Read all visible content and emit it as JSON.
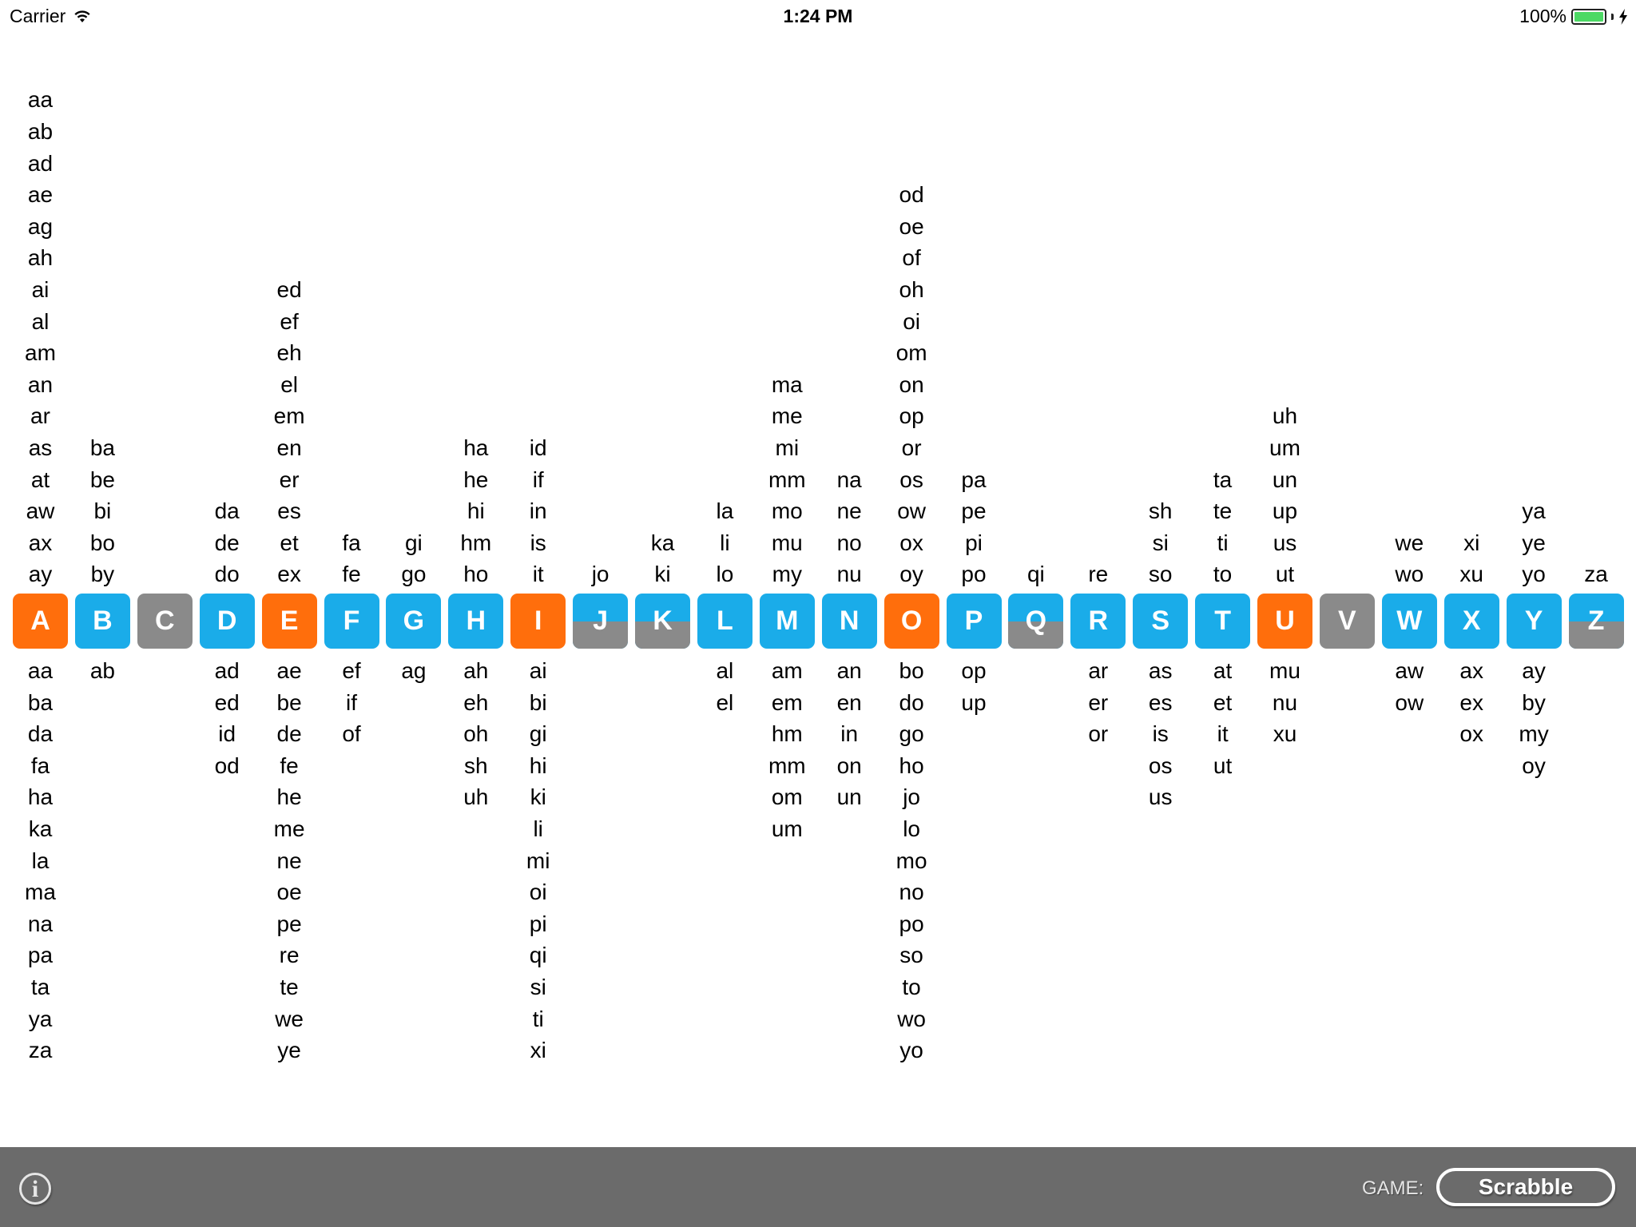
{
  "status_bar": {
    "carrier": "Carrier",
    "time": "1:24 PM",
    "battery_percent": "100%",
    "battery_level": 1.0
  },
  "colors": {
    "vowel": "#ff6e0c",
    "consonant": "#1aace9",
    "unused": "#8a8a8a",
    "toolbar": "#6b6b6b"
  },
  "letters": [
    {
      "letter": "A",
      "style": "vowel",
      "starts": [
        "aa",
        "ab",
        "ad",
        "ae",
        "ag",
        "ah",
        "ai",
        "al",
        "am",
        "an",
        "ar",
        "as",
        "at",
        "aw",
        "ax",
        "ay"
      ],
      "ends": [
        "aa",
        "ba",
        "da",
        "fa",
        "ha",
        "ka",
        "la",
        "ma",
        "na",
        "pa",
        "ta",
        "ya",
        "za"
      ]
    },
    {
      "letter": "B",
      "style": "consonant",
      "starts": [
        "ba",
        "be",
        "bi",
        "bo",
        "by"
      ],
      "ends": [
        "ab"
      ]
    },
    {
      "letter": "C",
      "style": "unused",
      "starts": [],
      "ends": []
    },
    {
      "letter": "D",
      "style": "consonant",
      "starts": [
        "da",
        "de",
        "do"
      ],
      "ends": [
        "ad",
        "ed",
        "id",
        "od"
      ]
    },
    {
      "letter": "E",
      "style": "vowel",
      "starts": [
        "ed",
        "ef",
        "eh",
        "el",
        "em",
        "en",
        "er",
        "es",
        "et",
        "ex"
      ],
      "ends": [
        "ae",
        "be",
        "de",
        "fe",
        "he",
        "me",
        "ne",
        "oe",
        "pe",
        "re",
        "te",
        "we",
        "ye"
      ]
    },
    {
      "letter": "F",
      "style": "consonant",
      "starts": [
        "fa",
        "fe"
      ],
      "ends": [
        "ef",
        "if",
        "of"
      ]
    },
    {
      "letter": "G",
      "style": "consonant",
      "starts": [
        "gi",
        "go"
      ],
      "ends": [
        "ag"
      ]
    },
    {
      "letter": "H",
      "style": "consonant",
      "starts": [
        "ha",
        "he",
        "hi",
        "hm",
        "ho"
      ],
      "ends": [
        "ah",
        "eh",
        "oh",
        "sh",
        "uh"
      ]
    },
    {
      "letter": "I",
      "style": "vowel",
      "starts": [
        "id",
        "if",
        "in",
        "is",
        "it"
      ],
      "ends": [
        "ai",
        "bi",
        "gi",
        "hi",
        "ki",
        "li",
        "mi",
        "oi",
        "pi",
        "qi",
        "si",
        "ti",
        "xi"
      ]
    },
    {
      "letter": "J",
      "style": "half",
      "starts": [
        "jo"
      ],
      "ends": []
    },
    {
      "letter": "K",
      "style": "half",
      "starts": [
        "ka",
        "ki"
      ],
      "ends": []
    },
    {
      "letter": "L",
      "style": "consonant",
      "starts": [
        "la",
        "li",
        "lo"
      ],
      "ends": [
        "al",
        "el"
      ]
    },
    {
      "letter": "M",
      "style": "consonant",
      "starts": [
        "ma",
        "me",
        "mi",
        "mm",
        "mo",
        "mu",
        "my"
      ],
      "ends": [
        "am",
        "em",
        "hm",
        "mm",
        "om",
        "um"
      ]
    },
    {
      "letter": "N",
      "style": "consonant",
      "starts": [
        "na",
        "ne",
        "no",
        "nu"
      ],
      "ends": [
        "an",
        "en",
        "in",
        "on",
        "un"
      ]
    },
    {
      "letter": "O",
      "style": "vowel",
      "starts": [
        "od",
        "oe",
        "of",
        "oh",
        "oi",
        "om",
        "on",
        "op",
        "or",
        "os",
        "ow",
        "ox",
        "oy"
      ],
      "ends": [
        "bo",
        "do",
        "go",
        "ho",
        "jo",
        "lo",
        "mo",
        "no",
        "po",
        "so",
        "to",
        "wo",
        "yo"
      ]
    },
    {
      "letter": "P",
      "style": "consonant",
      "starts": [
        "pa",
        "pe",
        "pi",
        "po"
      ],
      "ends": [
        "op",
        "up"
      ]
    },
    {
      "letter": "Q",
      "style": "half",
      "starts": [
        "qi"
      ],
      "ends": []
    },
    {
      "letter": "R",
      "style": "consonant",
      "starts": [
        "re"
      ],
      "ends": [
        "ar",
        "er",
        "or"
      ]
    },
    {
      "letter": "S",
      "style": "consonant",
      "starts": [
        "sh",
        "si",
        "so"
      ],
      "ends": [
        "as",
        "es",
        "is",
        "os",
        "us"
      ]
    },
    {
      "letter": "T",
      "style": "consonant",
      "starts": [
        "ta",
        "te",
        "ti",
        "to"
      ],
      "ends": [
        "at",
        "et",
        "it",
        "ut"
      ]
    },
    {
      "letter": "U",
      "style": "vowel",
      "starts": [
        "uh",
        "um",
        "un",
        "up",
        "us",
        "ut"
      ],
      "ends": [
        "mu",
        "nu",
        "xu"
      ]
    },
    {
      "letter": "V",
      "style": "unused",
      "starts": [],
      "ends": []
    },
    {
      "letter": "W",
      "style": "consonant",
      "starts": [
        "we",
        "wo"
      ],
      "ends": [
        "aw",
        "ow"
      ]
    },
    {
      "letter": "X",
      "style": "consonant",
      "starts": [
        "xi",
        "xu"
      ],
      "ends": [
        "ax",
        "ex",
        "ox"
      ]
    },
    {
      "letter": "Y",
      "style": "consonant",
      "starts": [
        "ya",
        "ye",
        "yo"
      ],
      "ends": [
        "ay",
        "by",
        "my",
        "oy"
      ]
    },
    {
      "letter": "Z",
      "style": "half",
      "starts": [
        "za"
      ],
      "ends": []
    }
  ],
  "toolbar": {
    "info_icon": "info-circle-icon",
    "info_glyph": "i",
    "game_label": "GAME:",
    "game_value": "Scrabble"
  }
}
